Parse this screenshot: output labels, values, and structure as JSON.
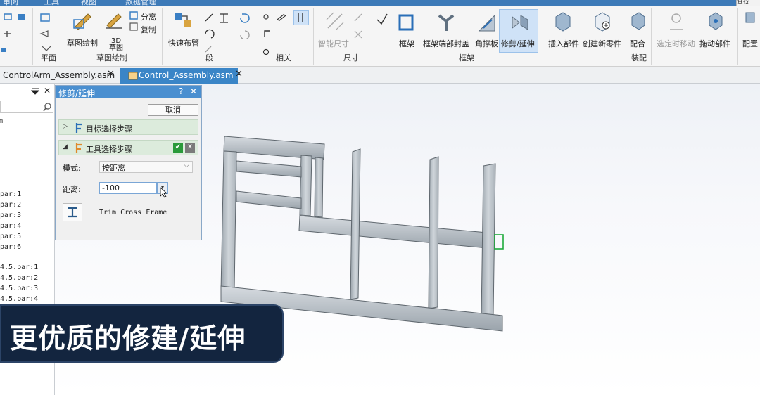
{
  "menu": {
    "items": [
      "审阅",
      "工具",
      "视图",
      "数据管理"
    ],
    "top_right": "查找"
  },
  "ribbon": {
    "sketch_group": {
      "sketch_draw": "草图绘制",
      "split": "分离",
      "copy": "复制",
      "sketch3d": "3D\n草图",
      "group_label": "草图绘制",
      "plane_label": "平面"
    },
    "pipe_group": {
      "quick_pipe": "快速布管",
      "segment": "段"
    },
    "related_label": "相关",
    "dim_group": {
      "smart_dim": "智能尺寸",
      "group_label": "尺寸"
    },
    "frame_group": {
      "frame": "框架",
      "end_cap": "框架端部封盖",
      "gusset": "角撑板",
      "trim_extend": "修剪/延伸",
      "group_label": "框架"
    },
    "assembly_group": {
      "insert_part": "插入部件",
      "new_part": "创建新零件",
      "mate": "配合",
      "move_selected": "选定时移动",
      "drag_part": "拖动部件",
      "group_label": "装配"
    },
    "config": "配置"
  },
  "tabs": [
    {
      "label": "ControlArm_Assembly.asm",
      "active": false
    },
    {
      "label": "Control_Assembly.asm",
      "active": true
    }
  ],
  "tree": {
    "items_a": [
      "m",
      "par:1",
      "par:2",
      "par:3",
      "par:4",
      "par:5",
      "par:6"
    ],
    "items_b": [
      "4.5.par:1",
      "4.5.par:2",
      "4.5.par:3",
      "4.5.par:4"
    ]
  },
  "dialog": {
    "title": "修剪/延伸",
    "help": "?",
    "close": "✕",
    "cancel": "取消",
    "step1": "目标选择步骤",
    "step2": "工具选择步骤",
    "mode_label": "模式:",
    "mode_value": "按距离",
    "distance_label": "距离:",
    "distance_value": "-100",
    "frame_type_label": "Trim Cross Frame"
  },
  "caption": "更优质的修建/延伸",
  "colors": {
    "accent": "#3a85c7",
    "caption_bg": "#13253f",
    "step_bg": "#dcebdc",
    "beam": "#c4cacf"
  }
}
